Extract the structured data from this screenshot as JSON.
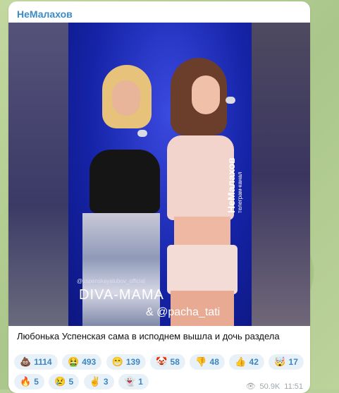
{
  "message": {
    "channel_name": "НеМалахов",
    "caption": "Любонька Успенская сама в исподнем вышла и дочь раздела",
    "video_overlay": {
      "watermark_title": "НеМалахов",
      "watermark_sub": "телеграм-канал",
      "credit_account": "@uspenskayalubov_official",
      "credit_title": "DIVA-MAMA",
      "credit_tag": "& @pacha_tati"
    },
    "reactions": [
      {
        "icon": "poop-emoji",
        "glyph": "💩",
        "count": "1114"
      },
      {
        "icon": "vomit-emoji",
        "glyph": "🤮",
        "count": "493"
      },
      {
        "icon": "grin-emoji",
        "glyph": "😁",
        "count": "139"
      },
      {
        "icon": "clown-emoji",
        "glyph": "🤡",
        "count": "58"
      },
      {
        "icon": "thumbs-down-emoji",
        "glyph": "👎",
        "count": "48"
      },
      {
        "icon": "thumbs-up-emoji",
        "glyph": "👍",
        "count": "42"
      },
      {
        "icon": "exploding-head-emoji",
        "glyph": "🤯",
        "count": "17"
      },
      {
        "icon": "fire-emoji",
        "glyph": "🔥",
        "count": "5"
      },
      {
        "icon": "sad-emoji",
        "glyph": "😢",
        "count": "5"
      },
      {
        "icon": "peace-hand-emoji",
        "glyph": "✌",
        "count": "3"
      },
      {
        "icon": "ghost-emoji",
        "glyph": "👻",
        "count": "1"
      }
    ],
    "views": "50.9K",
    "time": "11:51"
  }
}
